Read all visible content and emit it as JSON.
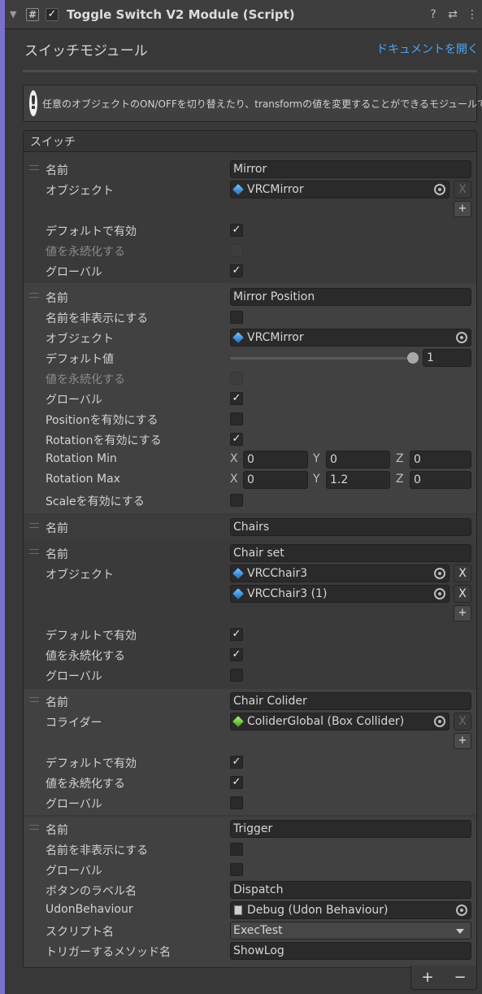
{
  "header": {
    "title": "Toggle Switch V2 Module (Script)",
    "enabled_mark": "✓",
    "foldout_icon": "triangle-down",
    "script_icon": "#",
    "help_icon": "?",
    "preset_icon": "⇄",
    "menu_icon": "⋮"
  },
  "module": {
    "title": "スイッチモジュール",
    "doc_link": "ドキュメントを開く"
  },
  "help": {
    "icon": "!",
    "text": "任意のオブジェクトのON/OFFを切り替えたり、transformの値を変更することができるモジュールです。"
  },
  "list": {
    "header": "スイッチ",
    "add": "+",
    "remove": "−"
  },
  "elements": {
    "mirror": {
      "name_label": "名前",
      "name_value": "Mirror",
      "object_label": "オブジェクト",
      "object_value": "VRCMirror",
      "default_label": "デフォルトで有効",
      "persist_label": "値を永続化する",
      "global_label": "グローバル",
      "default_checked": true,
      "persist_checked": false,
      "global_checked": true
    },
    "mirror_position": {
      "name_label": "名前",
      "name_value": "Mirror Position",
      "hide_label": "名前を非表示にする",
      "object_label": "オブジェクト",
      "object_value": "VRCMirror",
      "default_value_label": "デフォルト値",
      "default_value": "1",
      "slider_fraction": 1.0,
      "persist_label": "値を永続化する",
      "global_label": "グローバル",
      "position_label": "Positionを有効にする",
      "rotation_label": "Rotationを有効にする",
      "rotation_min_label": "Rotation Min",
      "rotation_max_label": "Rotation Max",
      "scale_label": "Scaleを有効にする",
      "rot_min": {
        "x": "0",
        "y": "0",
        "z": "0"
      },
      "rot_max": {
        "x": "0",
        "y": "1.2",
        "z": "0"
      },
      "axis_x": "X",
      "axis_y": "Y",
      "axis_z": "Z"
    },
    "chairs": {
      "name_label": "名前",
      "name_value": "Chairs"
    },
    "chair_set": {
      "name_label": "名前",
      "name_value": "Chair set",
      "object_label": "オブジェクト",
      "object_values": [
        "VRCChair3",
        "VRCChair3 (1)"
      ],
      "default_label": "デフォルトで有効",
      "persist_label": "値を永続化する",
      "global_label": "グローバル"
    },
    "chair_colider": {
      "name_label": "名前",
      "name_value": "Chair Colider",
      "collider_label": "コライダー",
      "collider_value": "ColiderGlobal (Box Collider)",
      "default_label": "デフォルトで有効",
      "persist_label": "値を永続化する",
      "global_label": "グローバル"
    },
    "trigger": {
      "name_label": "名前",
      "name_value": "Trigger",
      "hide_label": "名前を非表示にする",
      "global_label": "グローバル",
      "button_label_label": "ボタンのラベル名",
      "button_label_value": "Dispatch",
      "udon_label": "UdonBehaviour",
      "udon_value": "Debug (Udon Behaviour)",
      "script_label": "スクリプト名",
      "script_value": "ExecTest",
      "method_label": "トリガーするメソッド名",
      "method_value": "ShowLog"
    }
  },
  "marks": {
    "check": "✓",
    "x": "X",
    "plus": "+"
  },
  "colors": {
    "link": "#4ea4f5",
    "accent_strip": "#7b6fcf"
  }
}
